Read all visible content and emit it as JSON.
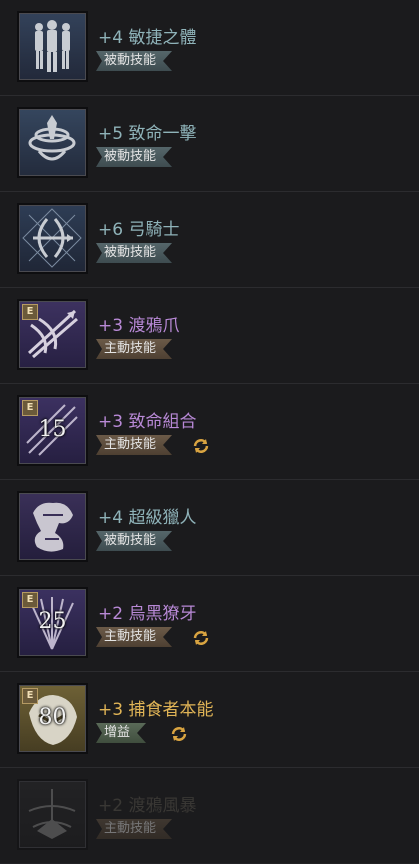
{
  "colors": {
    "passive_title": "#8fb3b9",
    "active_title": "#b889d6",
    "buff_title": "#e0b456",
    "dim_title": "#5e5a50",
    "cycle": "#d9a441"
  },
  "skills": [
    {
      "title": "+4 敏捷之體",
      "badge": "被動技能",
      "type": "passive",
      "icon": "agility-body-icon"
    },
    {
      "title": "+5 致命一擊",
      "badge": "被動技能",
      "type": "passive",
      "icon": "deadly-strike-icon"
    },
    {
      "title": "+6 弓騎士",
      "badge": "被動技能",
      "type": "passive",
      "icon": "bow-knight-icon"
    },
    {
      "title": "+3 渡鴉爪",
      "badge": "主動技能",
      "type": "active",
      "icon": "raven-claw-icon",
      "tag": "E"
    },
    {
      "title": "+3 致命組合",
      "badge": "主動技能",
      "type": "active",
      "icon": "deadly-combo-icon",
      "tag": "E",
      "number": "15",
      "cycle": true
    },
    {
      "title": "+4 超級獵人",
      "badge": "被動技能",
      "type": "passive",
      "icon": "super-hunter-icon"
    },
    {
      "title": "+2 烏黑獠牙",
      "badge": "主動技能",
      "type": "active",
      "icon": "black-fang-icon",
      "tag": "E",
      "number": "25",
      "cycle": true
    },
    {
      "title": "+3 捕食者本能",
      "badge": "增益",
      "type": "buff",
      "icon": "predator-instinct-icon",
      "tag": "E",
      "number": "80",
      "cycle": true
    },
    {
      "title": "+2 渡鴉風暴",
      "badge": "主動技能",
      "type": "dim",
      "icon": "raven-storm-icon"
    }
  ]
}
